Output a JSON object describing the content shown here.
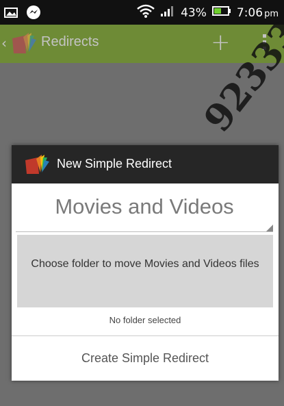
{
  "status_bar": {
    "battery": "43%",
    "time": "7:06",
    "time_suffix": "pm",
    "icons": [
      "picture-icon",
      "messenger-icon",
      "wifi-icon",
      "signal-icon",
      "battery-icon"
    ]
  },
  "app_bar": {
    "title": "Redirects",
    "back_icon": "back-chevron-icon",
    "add_icon": "plus-icon",
    "menu_icon": "overflow-menu-icon",
    "color": "#669900"
  },
  "watermark": "92333",
  "dialog": {
    "title": "New Simple Redirect",
    "category_selected": "Movies and Videos",
    "choose_folder_label": "Choose folder to move Movies and Videos files",
    "folder_status": "No folder selected",
    "create_button": "Create Simple Redirect"
  }
}
